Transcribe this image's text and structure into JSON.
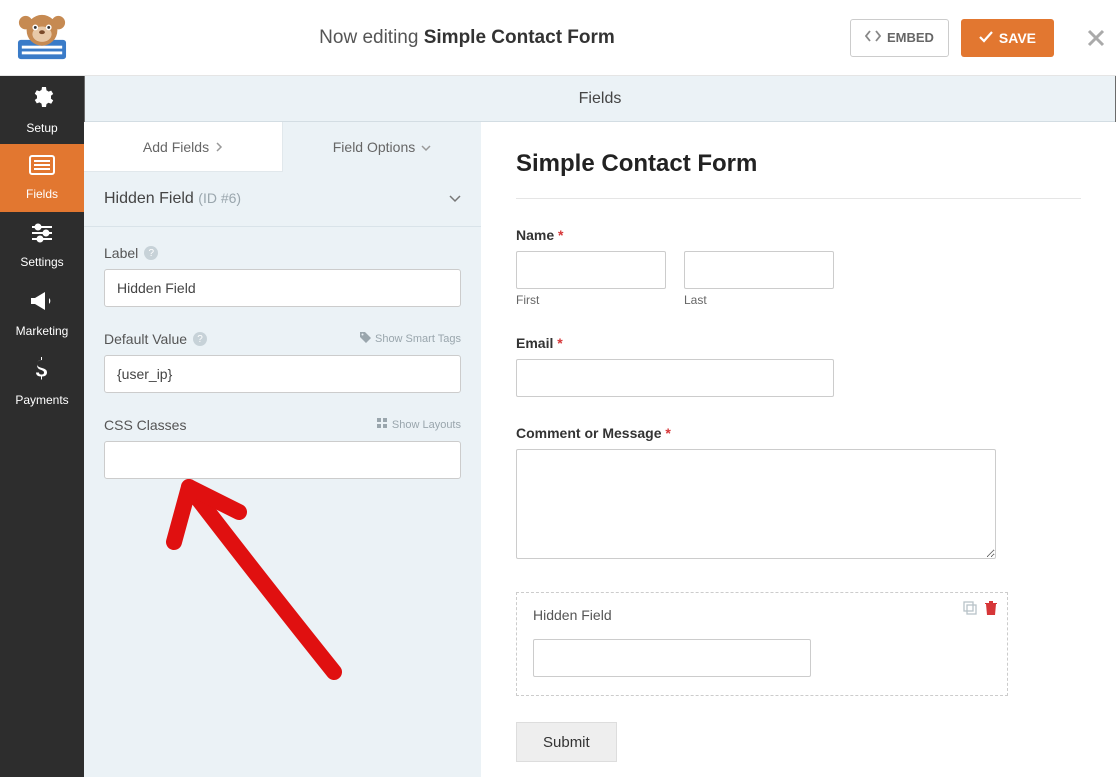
{
  "header": {
    "editing_prefix": "Now editing ",
    "form_name": "Simple Contact Form",
    "embed_label": "EMBED",
    "save_label": "SAVE"
  },
  "nav": {
    "setup": "Setup",
    "fields": "Fields",
    "settings": "Settings",
    "marketing": "Marketing",
    "payments": "Payments"
  },
  "fields_title": "Fields",
  "tabs": {
    "add_fields": "Add Fields",
    "field_options": "Field Options"
  },
  "field_panel": {
    "title": "Hidden Field",
    "id_text": "(ID #6)",
    "label_label": "Label",
    "label_value": "Hidden Field",
    "default_label": "Default Value",
    "default_value": "{user_ip}",
    "smart_tags": "Show Smart Tags",
    "css_label": "CSS Classes",
    "css_value": "",
    "layouts": "Show Layouts"
  },
  "preview": {
    "title": "Simple Contact Form",
    "name_label": "Name",
    "first_label": "First",
    "last_label": "Last",
    "email_label": "Email",
    "comment_label": "Comment or Message",
    "hidden_label": "Hidden Field",
    "submit_label": "Submit"
  }
}
